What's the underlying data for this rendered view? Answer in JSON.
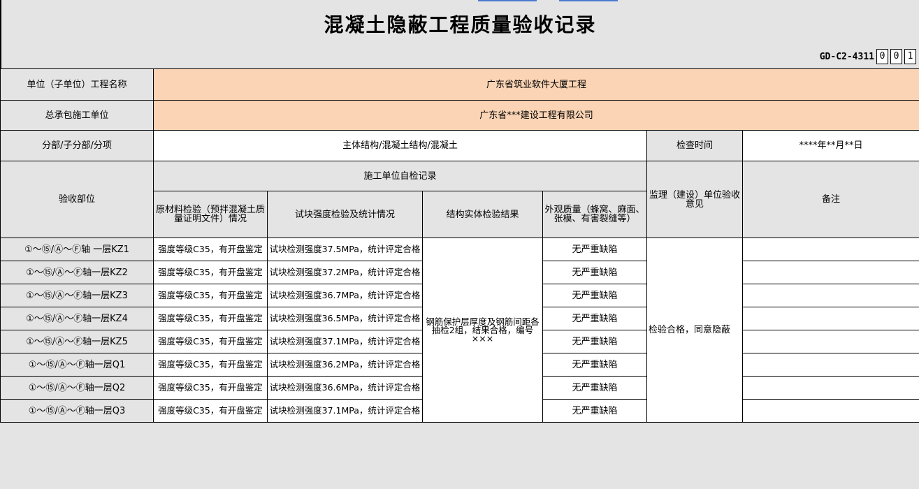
{
  "title": "混凝土隐蔽工程质量验收记录",
  "code": {
    "label": "GD-C2-4311",
    "digits": [
      "0",
      "0",
      "1"
    ]
  },
  "rows": {
    "project_name_label": "单位（子单位）工程名称",
    "project_name_value": "广东省筑业软件大厦工程",
    "contractor_label": "总承包施工单位",
    "contractor_value": "广东省***建设工程有限公司",
    "division_label": "分部/子分部/分项",
    "division_value": "主体结构/混凝土结构/混凝土",
    "check_time_label": "检查时间",
    "check_time_value": "****年**月**日"
  },
  "headers": {
    "acceptance_part": "验收部位",
    "self_check": "施工单位自检记录",
    "raw_material": "原材料检验（预拌混凝土质量证明文件）情况",
    "test_block": "试块强度检验及统计情况",
    "structure_result": "结构实体检验结果",
    "appearance": "外观质量（蜂窝、麻面、张模、有害裂缝等）",
    "supervisor": "监理（建设）单位验收意见",
    "remarks": "备注"
  },
  "merged": {
    "structure_result_value": "钢筋保护层厚度及钢筋间距各抽检2组，结果合格，编号×××",
    "supervisor_value": "检验合格，同意隐蔽"
  },
  "data_rows": [
    {
      "part": "①～⑮/Ⓐ～Ⓕ轴 一层KZ1",
      "material": "强度等级C35，有开盘鉴定",
      "strength": "试块检测强度37.5MPa，统计评定合格",
      "appearance": "无严重缺陷",
      "remark": ""
    },
    {
      "part": "①～⑮/Ⓐ～Ⓕ轴一层KZ2",
      "material": "强度等级C35，有开盘鉴定",
      "strength": "试块检测强度37.2MPa，统计评定合格",
      "appearance": "无严重缺陷",
      "remark": ""
    },
    {
      "part": "①～⑮/Ⓐ～Ⓕ轴一层KZ3",
      "material": "强度等级C35，有开盘鉴定",
      "strength": "试块检测强度36.7MPa，统计评定合格",
      "appearance": "无严重缺陷",
      "remark": ""
    },
    {
      "part": "①～⑮/Ⓐ～Ⓕ轴一层KZ4",
      "material": "强度等级C35，有开盘鉴定",
      "strength": "试块检测强度36.5MPa，统计评定合格",
      "appearance": "无严重缺陷",
      "remark": ""
    },
    {
      "part": "①～⑮/Ⓐ～Ⓕ轴一层KZ5",
      "material": "强度等级C35，有开盘鉴定",
      "strength": "试块检测强度37.1MPa，统计评定合格",
      "appearance": "无严重缺陷",
      "remark": ""
    },
    {
      "part": "①～⑮/Ⓐ～Ⓕ轴一层Q1",
      "material": "强度等级C35，有开盘鉴定",
      "strength": "试块检测强度36.2MPa，统计评定合格",
      "appearance": "无严重缺陷",
      "remark": ""
    },
    {
      "part": "①～⑮/Ⓐ～Ⓕ轴一层Q2",
      "material": "强度等级C35，有开盘鉴定",
      "strength": "试块检测强度36.6MPa，统计评定合格",
      "appearance": "无严重缺陷",
      "remark": ""
    },
    {
      "part": "①～⑮/Ⓐ～Ⓕ轴一层Q3",
      "material": "强度等级C35，有开盘鉴定",
      "strength": "试块检测强度37.1MPa，统计评定合格",
      "appearance": "无严重缺陷",
      "remark": ""
    }
  ]
}
